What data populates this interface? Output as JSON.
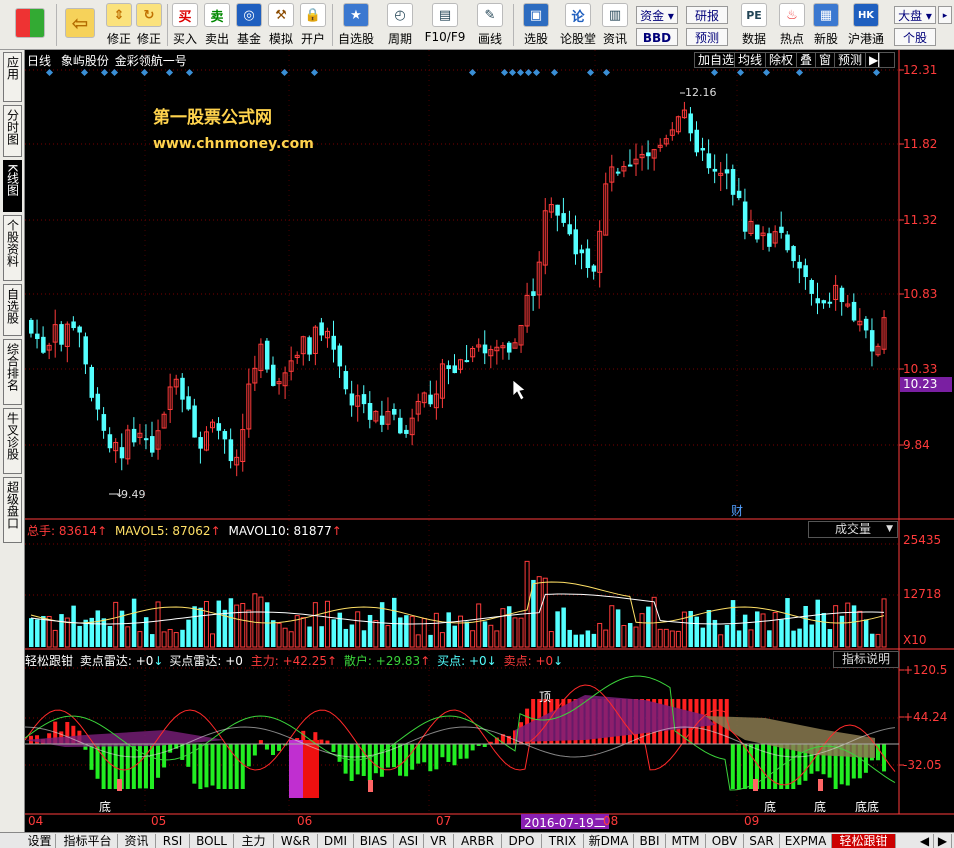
{
  "toolbar": {
    "buttons": [
      {
        "label": "",
        "icon": "grid-icon"
      },
      {
        "label": "",
        "icon": "back-arrow-icon"
      },
      {
        "label": "修正",
        "icon": "updown-arrows-icon"
      },
      {
        "label": "",
        "icon": "refresh-icon"
      },
      {
        "label": "买入",
        "icon": "buy-icon",
        "glyph": "买"
      },
      {
        "label": "卖出",
        "icon": "sell-icon",
        "glyph": "卖"
      },
      {
        "label": "基金",
        "icon": "fund-icon"
      },
      {
        "label": "模拟",
        "icon": "hammer-icon"
      },
      {
        "label": "开户",
        "icon": "lock-icon"
      },
      {
        "label": "自选股",
        "icon": "star-icon"
      },
      {
        "label": "周期",
        "icon": "clock-icon"
      },
      {
        "label": "F10/F9",
        "icon": "f10-icon"
      },
      {
        "label": "画线",
        "icon": "pencil-icon"
      },
      {
        "label": "选股",
        "icon": "screen-icon"
      },
      {
        "label": "论股堂",
        "icon": "forum-icon",
        "glyph": "论"
      },
      {
        "label": "资讯",
        "icon": "news-icon"
      },
      {
        "label": "数据",
        "icon": "pe-icon",
        "glyph": "PE"
      },
      {
        "label": "热点",
        "icon": "hot-icon"
      },
      {
        "label": "新股",
        "icon": "new-stock-icon"
      },
      {
        "label": "沪港通",
        "icon": "hk-connect-icon",
        "glyph": "HK"
      }
    ],
    "zijin": "资金",
    "bbd": "BBD",
    "yanbao": "研报",
    "yuce": "预测",
    "dapan": "大盘",
    "gegu": "个股"
  },
  "left_tabs": [
    "应用",
    "分时图",
    "K线图",
    "个股资料",
    "自选股",
    "综合排名",
    "牛叉诊股",
    "超级盘口"
  ],
  "header": {
    "period": "日线",
    "stock": "象屿股份",
    "formula": "金彩领航一号",
    "buttons": [
      "加自选",
      "均线",
      "除权",
      "叠",
      "窗",
      "预测"
    ]
  },
  "watermark": {
    "line1": "第一股票公式网",
    "line2": "www.chnmoney.com"
  },
  "price_axis": [
    "12.31",
    "11.82",
    "11.32",
    "10.83",
    "10.33",
    "9.84"
  ],
  "current_price": "10.23",
  "high_label": "12.16",
  "low_label": "9.49",
  "cai_label": "财",
  "volume": {
    "total_label": "总手:",
    "total": "83614",
    "mavol5_label": "MAVOL5:",
    "mavol5": "87062",
    "mavol10_label": "MAVOL10:",
    "mavol10": "81877",
    "selector": "成交量",
    "axis": [
      "25435",
      "12718",
      "X10"
    ]
  },
  "indicator": {
    "name": "轻松跟钳",
    "sell_radar_label": "卖点雷达:",
    "sell_radar": "+0",
    "buy_radar_label": "买点雷达:",
    "buy_radar": "+0",
    "main_label": "主力:",
    "main": "+42.25",
    "retail_label": "散户:",
    "retail": "+29.83",
    "buy_label": "买点:",
    "buy": "+0",
    "sell_label": "卖点:",
    "sell": "+0",
    "help": "指标说明",
    "axis": [
      "+120.5",
      "+44.24",
      "-32.05"
    ],
    "top_mark": "顶",
    "bottom_mark": "底",
    "double_bottom_mark": "底底"
  },
  "months": [
    "04",
    "05",
    "06",
    "07",
    "08",
    "09"
  ],
  "cursor_date": "2016-07-19二",
  "bottom_tabs": [
    "设置",
    "指标平台",
    "资讯",
    "RSI",
    "BOLL",
    "主力",
    "W&R",
    "DMI",
    "BIAS",
    "ASI",
    "VR",
    "ARBR",
    "DPO",
    "TRIX",
    "新DMA",
    "BBI",
    "MTM",
    "OBV",
    "SAR",
    "EXPMA",
    "轻松跟钳"
  ],
  "colors": {
    "up": "#ff3b3b",
    "down": "#54ffff",
    "axis": "#ff3b3b",
    "accent": "#7a1fa2"
  }
}
